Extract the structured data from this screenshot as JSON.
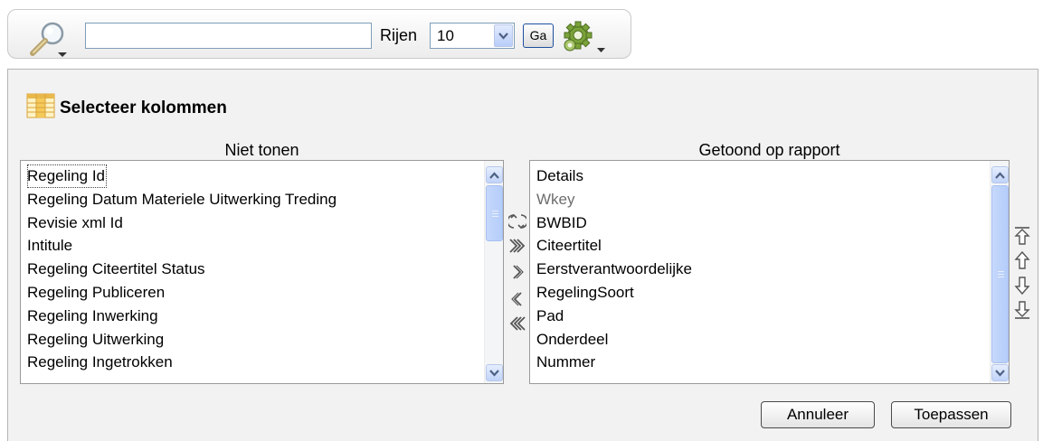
{
  "toolbar": {
    "search_value": "",
    "rows_label": "Rijen",
    "rows_value": "10",
    "go_label": "Ga",
    "icons": [
      "search-icon",
      "gear-icon",
      "chevron-down-icon"
    ]
  },
  "panel": {
    "title": "Selecteer kolommen",
    "hidden_header": "Niet tonen",
    "shown_header": "Getoond op rapport",
    "hidden_columns": [
      "Regeling Id",
      "Regeling Datum Materiele Uitwerking Treding",
      "Revisie xml Id",
      "Intitule",
      "Regeling Citeertitel Status",
      "Regeling Publiceren",
      "Regeling Inwerking",
      "Regeling Uitwerking",
      "Regeling Ingetrokken"
    ],
    "shown_columns": [
      "Details",
      "Wkey",
      "BWBID",
      "Citeertitel",
      "Eerstverantwoordelijke",
      "RegelingSoort",
      "Pad",
      "Onderdeel",
      "Nummer"
    ],
    "cancel_label": "Annuleer",
    "apply_label": "Toepassen"
  },
  "colors": {
    "accent": "#1f4f9e",
    "scrollbar": "#c0d3f9",
    "panel_bg": "#f2f2f2"
  }
}
